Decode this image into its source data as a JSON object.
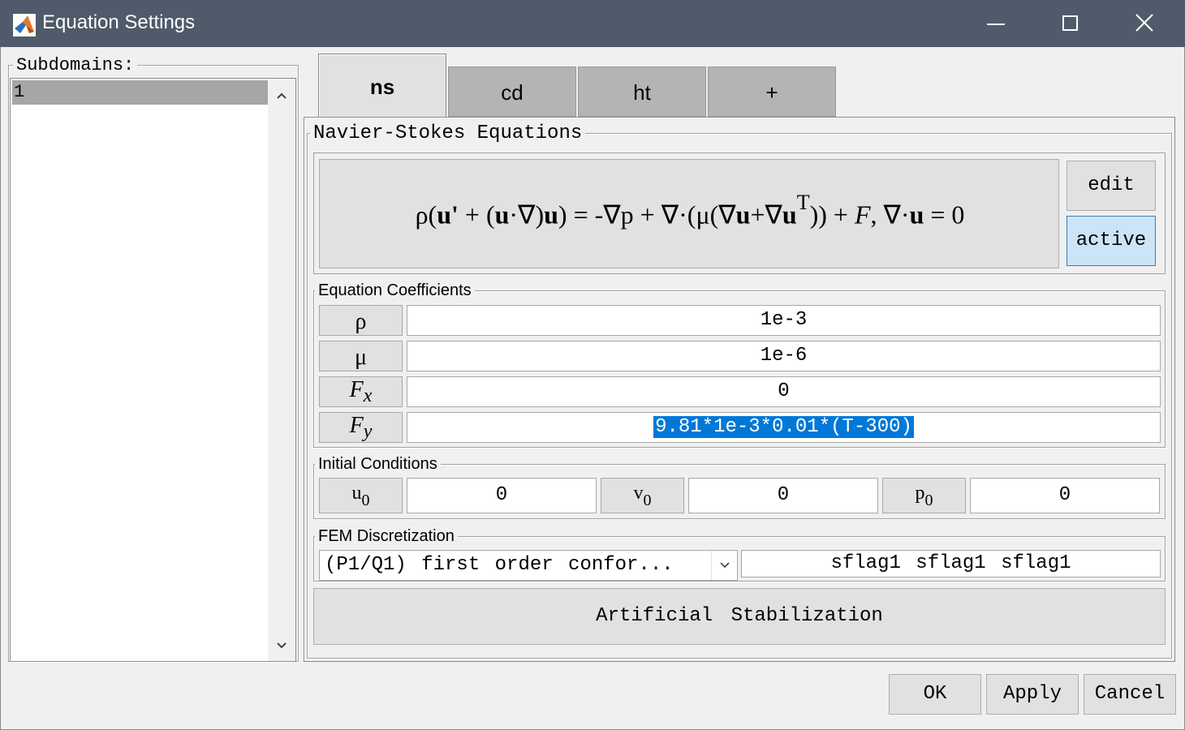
{
  "window": {
    "title": "Equation Settings",
    "controls": [
      "minimize",
      "maximize",
      "close"
    ]
  },
  "subdomains": {
    "legend": "Subdomains:",
    "items": [
      "1"
    ],
    "selected": "1"
  },
  "tabs": [
    {
      "label": "ns",
      "active": true
    },
    {
      "label": "cd",
      "active": false
    },
    {
      "label": "ht",
      "active": false
    },
    {
      "label": "+",
      "active": false
    }
  ],
  "equations": {
    "legend": "Navier-Stokes Equations",
    "equation": {
      "rho": "ρ",
      "open": "(",
      "u_prime": "u'",
      "plus1": " + (",
      "u1": "u",
      "dot1": "·",
      "nabla1": "∇",
      "close1": ")",
      "u2": "u",
      "close2": ") = -∇p + ∇",
      "dot2": "·",
      "mu_part": "(μ(∇",
      "u3": "u",
      "plus2": "+∇",
      "u4": "u",
      "sup_T": "T",
      "tail": ")) + ",
      "F": "F",
      "comma": ", ∇",
      "dot3": "·",
      "u5": "u",
      "eq0": " = 0"
    },
    "edit_label": "edit",
    "active_label": "active"
  },
  "coefficients": {
    "legend": "Equation Coefficients",
    "rows": [
      {
        "symbol": "ρ",
        "subscript": "",
        "value": "1e-3"
      },
      {
        "symbol": "μ",
        "subscript": "",
        "value": "1e-6"
      },
      {
        "symbol": "F",
        "subscript": "x",
        "value": "0"
      },
      {
        "symbol": "F",
        "subscript": "y",
        "value": "9.81*1e-3*0.01*(T-300)"
      }
    ]
  },
  "initial": {
    "legend": "Initial Conditions",
    "fields": [
      {
        "symbol": "u",
        "subscript": "0",
        "value": "0"
      },
      {
        "symbol": "v",
        "subscript": "0",
        "value": "0"
      },
      {
        "symbol": "p",
        "subscript": "0",
        "value": "0"
      }
    ]
  },
  "fem": {
    "legend": "FEM Discretization",
    "selected_option": "(P1/Q1) first order confor...",
    "flags": "sflag1 sflag1 sflag1"
  },
  "stabilization_label": "Artificial Stabilization",
  "buttons": {
    "ok": "OK",
    "apply": "Apply",
    "cancel": "Cancel"
  },
  "colors": {
    "titlebar": "#4f5b6a",
    "selection": "#0078d7",
    "active_button": "#cce4f7"
  }
}
